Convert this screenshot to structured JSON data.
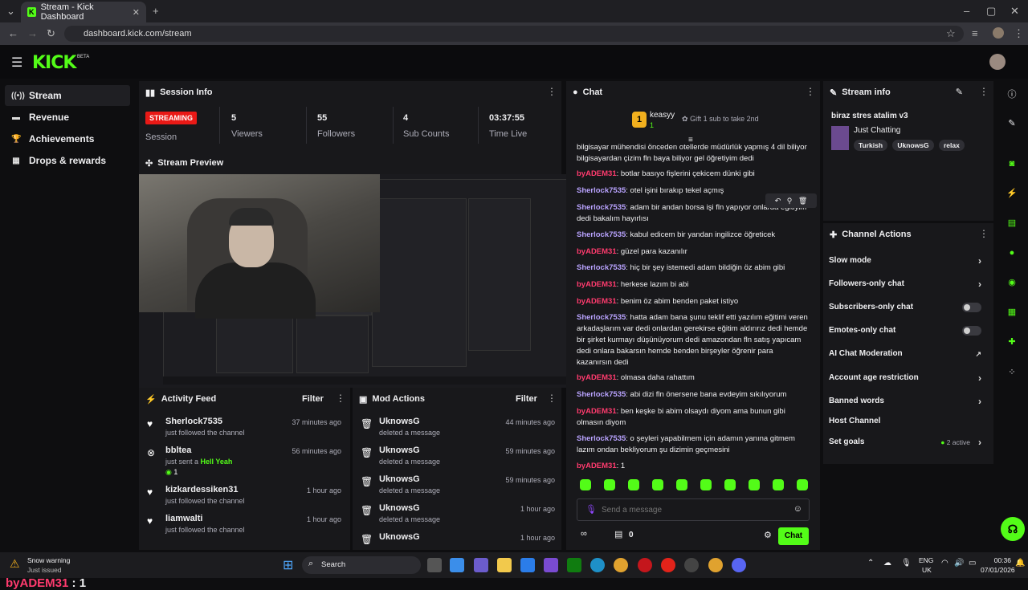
{
  "browser": {
    "tab_title": "Stream - Kick Dashboard",
    "url": "dashboard.kick.com/stream"
  },
  "header": {
    "logo": "KICK",
    "logo_tag": "BETA"
  },
  "sidebar": {
    "items": [
      {
        "label": "Stream",
        "icon": "broadcast-icon"
      },
      {
        "label": "Revenue",
        "icon": "cash-icon"
      },
      {
        "label": "Achievements",
        "icon": "trophy-icon"
      },
      {
        "label": "Drops & rewards",
        "icon": "gift-icon"
      }
    ]
  },
  "session": {
    "title": "Session Info",
    "status": "STREAMING",
    "stats": [
      {
        "value": "",
        "label": "Session"
      },
      {
        "value": "5",
        "label": "Viewers"
      },
      {
        "value": "55",
        "label": "Followers"
      },
      {
        "value": "4",
        "label": "Sub Counts"
      },
      {
        "value": "03:37:55",
        "label": "Time Live"
      }
    ]
  },
  "preview": {
    "title": "Stream Preview"
  },
  "overlay": {
    "name": "byADEM31",
    "text": ": 1"
  },
  "activity": {
    "title": "Activity Feed",
    "filter": "Filter",
    "items": [
      {
        "name": "Sherlock7535",
        "sub": "just followed the channel",
        "time": "37 minutes ago"
      },
      {
        "name": "bbltea",
        "sub": "just sent a",
        "extra": "Hell Yeah",
        "count": "1",
        "time": "56 minutes ago"
      },
      {
        "name": "kizkardessiken31",
        "sub": "just followed the channel",
        "time": "1 hour ago"
      },
      {
        "name": "liamwalti",
        "sub": "just followed the channel",
        "time": "1 hour ago"
      }
    ]
  },
  "mod": {
    "title": "Mod Actions",
    "filter": "Filter",
    "items": [
      {
        "name": "UknowsG",
        "sub": "deleted a message",
        "time": "44 minutes ago"
      },
      {
        "name": "UknowsG",
        "sub": "deleted a message",
        "time": "59 minutes ago"
      },
      {
        "name": "UknowsG",
        "sub": "deleted a message",
        "time": "59 minutes ago"
      },
      {
        "name": "UknowsG",
        "sub": "deleted a message",
        "time": "1 hour ago"
      },
      {
        "name": "UknowsG",
        "sub": "",
        "time": "1 hour ago"
      }
    ]
  },
  "chat": {
    "title": "Chat",
    "top_gifter": "keasyy",
    "top_gifter_count": "1",
    "gift_text": "Gift 1 sub to take 2nd",
    "messages": [
      {
        "user": "",
        "text": "bilgisayar mühendisi önceden otellerde müdürlük yapmış 4 dil biliyor bilgisayardan çizim fln baya biliyor gel öğretiyim dedi"
      },
      {
        "user": "byADEM31",
        "text": ": botlar basıyo fişlerini çekicem dünki gibi"
      },
      {
        "user": "Sherlock7535",
        "text": ": otel işini bırakıp tekel açmış"
      },
      {
        "user": "Sherlock7535",
        "text": ": adam bir andan borsa işi fln yapıyor onlarda eğitiyim dedi bakalım hayırlısı"
      },
      {
        "user": "Sherlock7535",
        "text": ": kabul edicem bir yandan ingilizce öğreticek"
      },
      {
        "user": "byADEM31",
        "text": ": güzel para kazanılır"
      },
      {
        "user": "Sherlock7535",
        "text": ": hiç bir şey istemedi adam bildiğin öz abim gibi"
      },
      {
        "user": "byADEM31",
        "text": ": herkese lazım bi abi"
      },
      {
        "user": "byADEM31",
        "text": ": benim öz abim benden paket istiyo"
      },
      {
        "user": "Sherlock7535",
        "text": ": hatta adam bana şunu teklif etti yazılım eğitimi veren arkadaşlarım var dedi onlardan gerekirse eğitim aldırırız dedi hemde bir şirket kurmayı düşünüyorum dedi amazondan fln satış yapıcam dedi onlara bakarsın hemde benden birşeyler öğrenir para kazanırsın dedi"
      },
      {
        "user": "byADEM31",
        "text": ": olmasa daha rahattım"
      },
      {
        "user": "Sherlock7535",
        "text": ": abi dizi fln önersene bana evdeyim sıkılıyorum"
      },
      {
        "user": "byADEM31",
        "text": ": ben keşke bi abim olsaydı diyom ama bunun gibi olmasın diyom"
      },
      {
        "user": "Sherlock7535",
        "text": ": o şeyleri yapabilmem için adamın yanına gitmem lazım ondan bekliyorum şu dizimin geçmesini"
      },
      {
        "user": "byADEM31",
        "text": ": 1"
      }
    ],
    "input_placeholder": "Send a message",
    "sub_count": "0",
    "send_label": "Chat"
  },
  "stream_info": {
    "title": "Stream info",
    "stream_title": "biraz stres atalim v3",
    "category": "Just Chatting",
    "tags": [
      "Turkish",
      "UknowsG",
      "relax"
    ]
  },
  "channel_actions": {
    "title": "Channel Actions",
    "items": [
      {
        "label": "Slow mode",
        "control": "chevron"
      },
      {
        "label": "Followers-only chat",
        "control": "chevron"
      },
      {
        "label": "Subscribers-only chat",
        "control": "toggle"
      },
      {
        "label": "Emotes-only chat",
        "control": "toggle"
      },
      {
        "label": "AI Chat Moderation",
        "control": "external"
      },
      {
        "label": "Account age restriction",
        "control": "chevron"
      },
      {
        "label": "Banned words",
        "control": "chevron"
      },
      {
        "label": "Host Channel",
        "control": "none"
      },
      {
        "label": "Set goals",
        "control": "chevron",
        "status": "2 active"
      }
    ]
  },
  "taskbar": {
    "weather_title": "Snow warning",
    "weather_sub": "Just issued",
    "search": "Search",
    "lang1": "ENG",
    "lang2": "UK",
    "time": "00:36",
    "date": "07/01/2026"
  },
  "colors": {
    "accent": "#53fc18",
    "live": "#e91916",
    "user_sherlock": "#b9a3ff",
    "user_adem": "#ff3b6e"
  }
}
